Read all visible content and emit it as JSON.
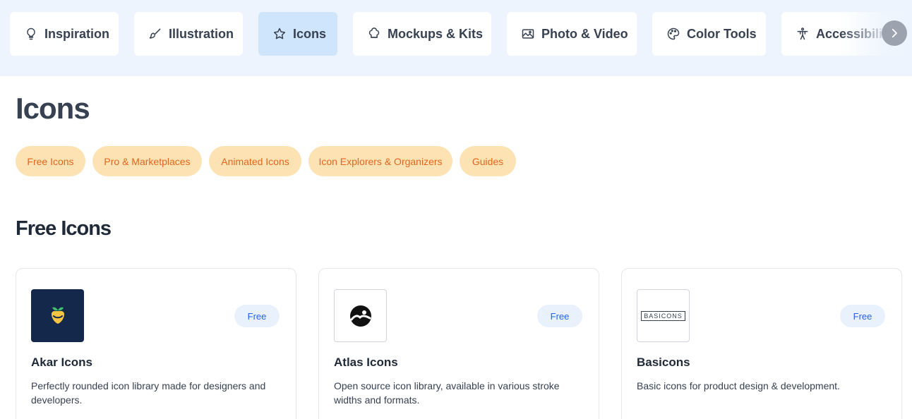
{
  "categories": [
    {
      "label": "Inspiration",
      "icon": "lightbulb-icon",
      "active": false
    },
    {
      "label": "Illustration",
      "icon": "brush-icon",
      "active": false
    },
    {
      "label": "Icons",
      "icon": "star-icon",
      "active": true
    },
    {
      "label": "Mockups & Kits",
      "icon": "chef-hat-icon",
      "active": false
    },
    {
      "label": "Photo & Video",
      "icon": "image-icon",
      "active": false
    },
    {
      "label": "Color Tools",
      "icon": "palette-icon",
      "active": false
    },
    {
      "label": "Accessibility",
      "icon": "accessibility-icon",
      "active": false
    }
  ],
  "page": {
    "title": "Icons"
  },
  "filters": [
    "Free Icons",
    "Pro & Marketplaces",
    "Animated Icons",
    "Icon Explorers & Organizers",
    "Guides"
  ],
  "section": {
    "title": "Free Icons"
  },
  "cards": [
    {
      "title": "Akar Icons",
      "badge": "Free",
      "description": "Perfectly rounded icon library made for designers and developers."
    },
    {
      "title": "Atlas Icons",
      "badge": "Free",
      "description": "Open source icon library, available in various stroke widths and formats."
    },
    {
      "title": "Basicons",
      "badge": "Free",
      "description": "Basic icons for product design & development.",
      "logo_text": "BASICONS"
    }
  ],
  "colors": {
    "topbar_bg": "#edf4fd",
    "active_tab": "#cfe5fb",
    "pill_bg": "#fde3b4",
    "pill_text": "#e0661d",
    "badge_bg": "#e8f1fc",
    "badge_text": "#2563eb"
  }
}
